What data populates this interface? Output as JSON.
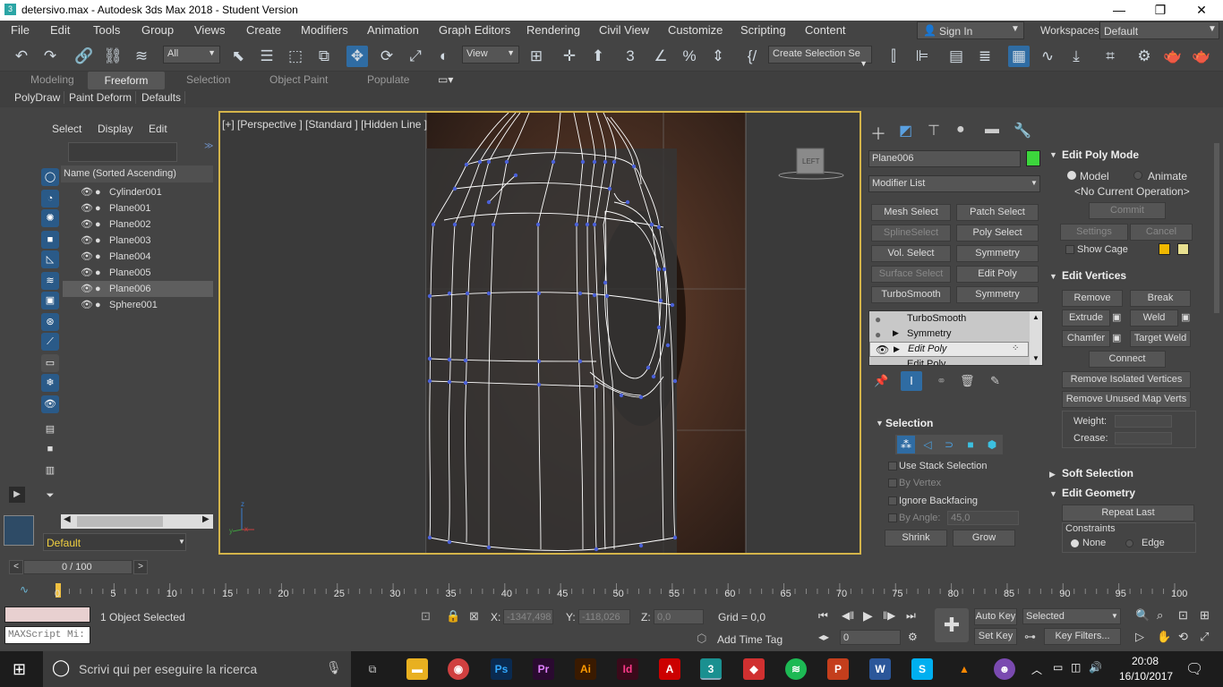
{
  "window": {
    "title": "detersivo.max - Autodesk 3ds Max 2018 - Student Version",
    "min": "—",
    "max": "❐",
    "close": "✕"
  },
  "menu": [
    "File",
    "Edit",
    "Tools",
    "Group",
    "Views",
    "Create",
    "Modifiers",
    "Animation",
    "Graph Editors",
    "Rendering",
    "Civil View",
    "Customize",
    "Scripting",
    "Content"
  ],
  "signin": "Sign In",
  "workspaces_label": "Workspaces:",
  "workspace": "Default",
  "toolbar": {
    "filter": "All",
    "view": "View",
    "selection_set": "Create Selection Se"
  },
  "ribbon": {
    "tabs": [
      "Modeling",
      "Freeform",
      "Selection",
      "Object Paint",
      "Populate"
    ],
    "active": "Freeform",
    "subtabs": [
      "PolyDraw",
      "Paint Deform",
      "Defaults"
    ]
  },
  "scene_explorer": {
    "tabs": [
      "Select",
      "Display",
      "Edit"
    ],
    "column": "Name (Sorted Ascending)",
    "items": [
      "Cylinder001",
      "Plane001",
      "Plane002",
      "Plane003",
      "Plane004",
      "Plane005",
      "Plane006",
      "Sphere001"
    ],
    "selected": "Plane006",
    "layer": "Default"
  },
  "viewport": {
    "label": "[+] [Perspective ] [Standard ] [Hidden Line ]",
    "cube": "LEFT"
  },
  "command_panel": {
    "object_name": "Plane006",
    "modifier_list": "Modifier List",
    "buttons": [
      "Mesh Select",
      "Patch Select",
      "SplineSelect",
      "Poly Select",
      "Vol. Select",
      "Symmetry",
      "Surface Select",
      "Edit Poly",
      "TurboSmooth",
      "Symmetry"
    ],
    "stack": [
      "TurboSmooth",
      "Symmetry",
      "Edit Poly",
      "Edit Poly"
    ],
    "selection": {
      "title": "Selection",
      "use_stack": "Use Stack Selection",
      "by_vertex": "By Vertex",
      "ignore_backfacing": "Ignore Backfacing",
      "by_angle": "By Angle:",
      "angle": "45,0",
      "shrink": "Shrink",
      "grow": "Grow"
    }
  },
  "edit_poly": {
    "mode_title": "Edit Poly Mode",
    "model": "Model",
    "animate": "Animate",
    "no_op": "<No Current Operation>",
    "commit": "Commit",
    "settings": "Settings",
    "cancel": "Cancel",
    "show_cage": "Show Cage",
    "edit_vertices": "Edit Vertices",
    "remove": "Remove",
    "break": "Break",
    "extrude": "Extrude",
    "weld": "Weld",
    "chamfer": "Chamfer",
    "target_weld": "Target Weld",
    "connect": "Connect",
    "remove_isolated": "Remove Isolated Vertices",
    "remove_unused": "Remove Unused Map Verts",
    "weight": "Weight:",
    "crease": "Crease:",
    "soft_selection": "Soft Selection",
    "edit_geometry": "Edit Geometry",
    "repeat_last": "Repeat Last",
    "constraints": "Constraints",
    "none": "None",
    "edge": "Edge"
  },
  "timeline": {
    "frame": "0 / 100",
    "ticks": [
      "0",
      "5",
      "10",
      "15",
      "20",
      "25",
      "30",
      "35",
      "40",
      "45",
      "50",
      "55",
      "60",
      "65",
      "70",
      "75",
      "80",
      "85",
      "90",
      "95",
      "100"
    ]
  },
  "status": {
    "maxscript": "MAXScript Mi:",
    "selected": "1 Object Selected",
    "x_label": "X:",
    "x": "-1347,498",
    "y_label": "Y:",
    "y": "-118,026",
    "z_label": "Z:",
    "z": "0,0",
    "grid": "Grid = 0,0",
    "add_time_tag": "Add Time Tag",
    "auto_key": "Auto Key",
    "set_key": "Set Key",
    "key_mode": "Selected",
    "key_filters": "Key Filters...",
    "frame_field": "0"
  },
  "taskbar": {
    "search": "Scrivi qui per eseguire la ricerca",
    "time": "20:08",
    "date": "16/10/2017"
  },
  "colors": {
    "accent": "#3a8fd6",
    "viewport_border": "#d4b44a",
    "object_color": "#3cd63c"
  }
}
